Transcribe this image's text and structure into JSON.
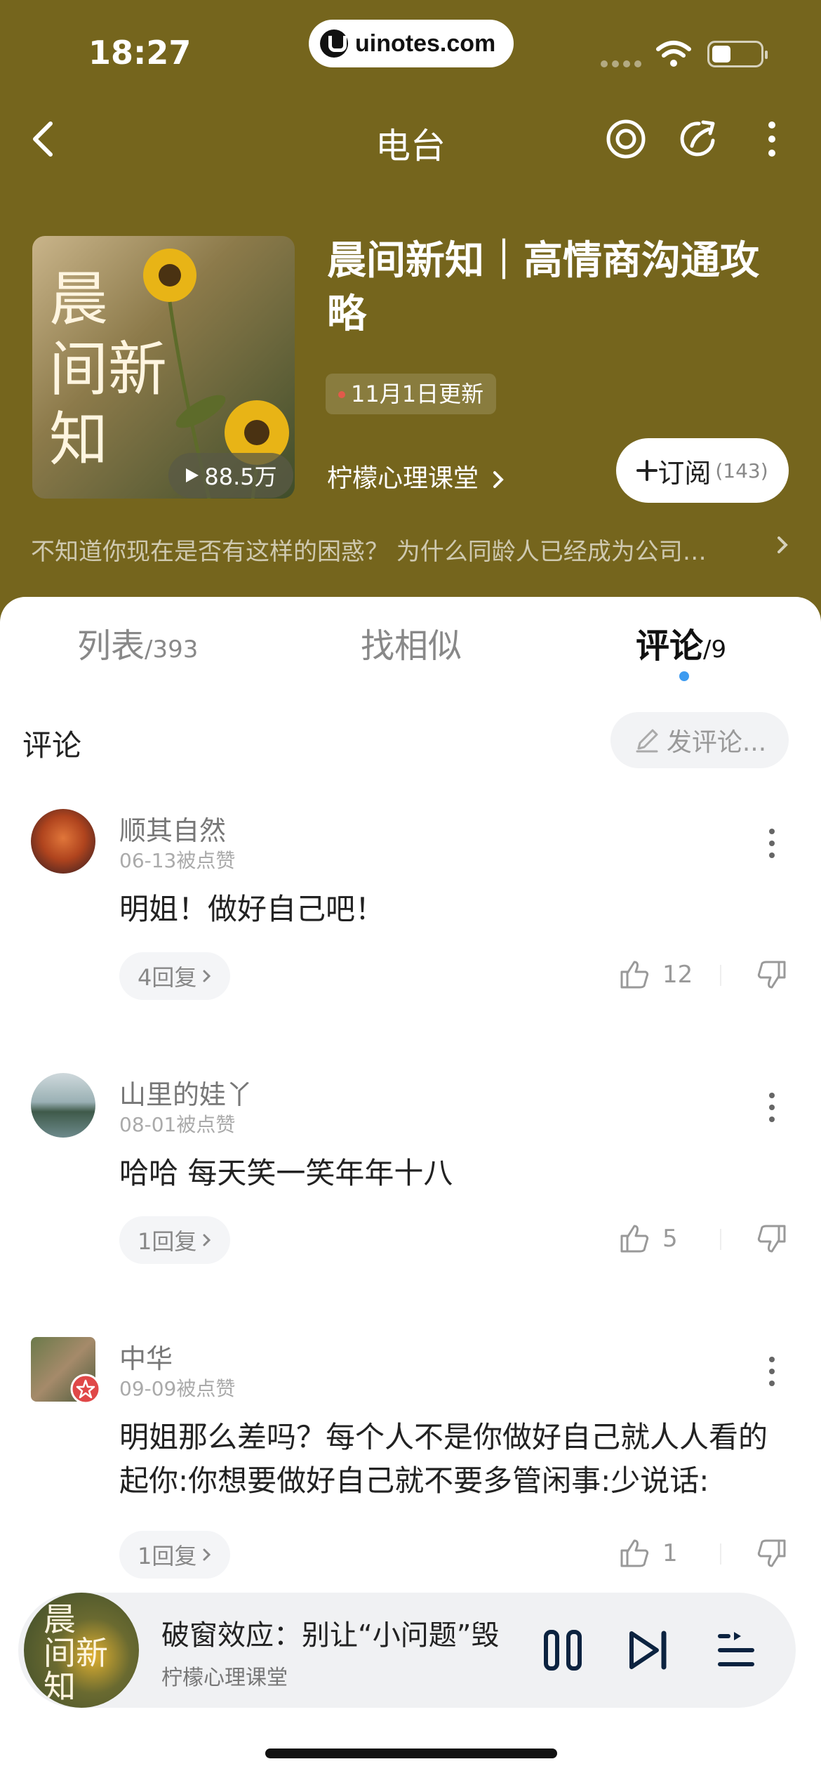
{
  "status": {
    "time": "18:27",
    "watermark": "uinotes.com"
  },
  "nav": {
    "title": "电台"
  },
  "album": {
    "cover_text": [
      "晨",
      "间新",
      "知"
    ],
    "play_count": "88.5万",
    "title": "晨间新知｜高情商沟通攻略",
    "update": "11月1日更新",
    "author": "柠檬心理课堂",
    "subscribe_label": "订阅",
    "subscribe_count": "(143)",
    "intro": "不知道你现在是否有这样的困惑？   为什么同龄人已经成为公司…"
  },
  "tabs": [
    {
      "label": "列表",
      "count": "/393"
    },
    {
      "label": "找相似",
      "count": ""
    },
    {
      "label": "评论",
      "count": "/9"
    }
  ],
  "comments_section": {
    "label": "评论",
    "post_button": "发评论..."
  },
  "comments": [
    {
      "name": "顺其自然",
      "date": "06-13被点赞",
      "text": "明姐！做好自己吧！",
      "replies": "4回复",
      "likes": "12"
    },
    {
      "name": "山里的娃丫",
      "date": "08-01被点赞",
      "text": "哈哈 每天笑一笑年年十八",
      "replies": "1回复",
      "likes": "5"
    },
    {
      "name": "中华",
      "date": "09-09被点赞",
      "text": "明姐那么差吗？每个人不是你做好自己就人人看的起你:你想要做好自己就不要多管闲事:少说话:",
      "replies": "1回复",
      "likes": "1"
    }
  ],
  "player": {
    "art_text": [
      "晨",
      "间新",
      "知"
    ],
    "title": "破窗效应：别让“小问题”毁",
    "subtitle": "柠檬心理课堂"
  },
  "colors": {
    "header_bg": "#75651d",
    "accent_dot": "#3d9bf0",
    "update_dot": "#e25a4a"
  },
  "icons": [
    "back-icon",
    "target-icon",
    "share-icon",
    "more-icon",
    "play-icon",
    "chevron-right-icon",
    "plus-icon",
    "edit-icon",
    "like-icon",
    "dislike-icon",
    "pause-icon",
    "next-icon",
    "playlist-icon"
  ]
}
